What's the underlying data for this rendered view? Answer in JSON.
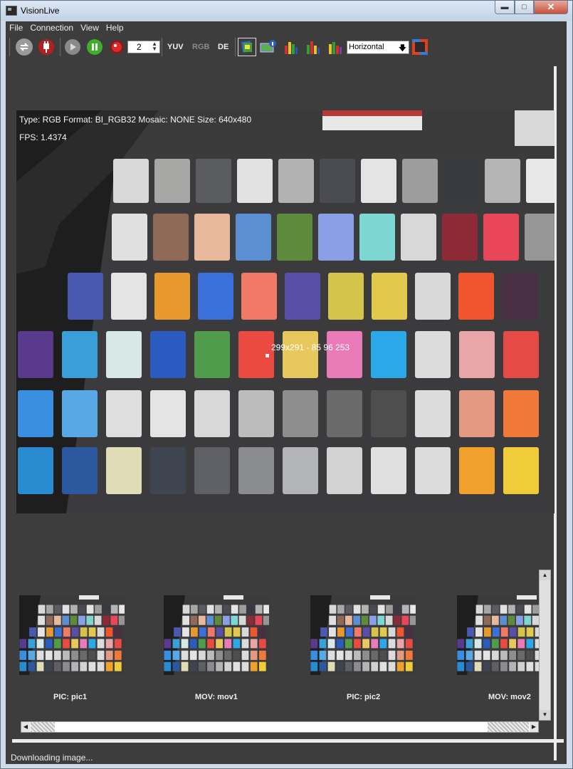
{
  "window": {
    "title": "VisionLive"
  },
  "menu": {
    "items": [
      "File",
      "Connection",
      "View",
      "Help"
    ]
  },
  "toolbar": {
    "icons": [
      "refresh-icon",
      "plug-icon",
      "play-icon",
      "pause-icon",
      "record-icon",
      "color-picture-icon",
      "monitor-info-icon",
      "histogram-icon",
      "histogram-icon",
      "histogram-icon",
      "layout-icon"
    ],
    "spin_value": "2",
    "yuv_label": "YUV",
    "rgb_label": "RGB",
    "de_label": "DE",
    "orientation": "Horizontal"
  },
  "viewer": {
    "info_line": "Type: RGB Format: BI_RGB32 Mosaic: NONE Size: 640x480",
    "fps_line": "FPS: 1.4374",
    "pixel_readout": "299x291 - 85 96 253"
  },
  "gallery": {
    "items": [
      {
        "label": "PIC: pic1"
      },
      {
        "label": "MOV: mov1"
      },
      {
        "label": "PIC: pic2"
      },
      {
        "label": "MOV: mov2"
      }
    ]
  },
  "status": {
    "text": "Downloading image..."
  },
  "chart_colors": {
    "row1": [
      "#d8d8d8",
      "#a7a7a5",
      "#5a5c60",
      "#e2e2e2",
      "#b2b2b2",
      "#4a4c52",
      "#e4e4e4",
      "#9d9d9d",
      "#383a40",
      "#b4b4b4",
      "#e8e8e8"
    ],
    "row2": [
      "#e0e0e0",
      "#8f6a57",
      "#e8b89c",
      "#5b8fd1",
      "#5e8a3c",
      "#8aa0e6",
      "#7ed6d2",
      "#d8d8d8",
      "#8c2a35",
      "#e8475a",
      "#969696"
    ],
    "row3": [
      "#4a58b0",
      "#e4e4e4",
      "#e8992e",
      "#3a70d8",
      "#f07a66",
      "#5a4ea6",
      "#d4c44a",
      "#e2c84c",
      "#d8d8d8",
      "#f0552e",
      "#4a2e44"
    ],
    "row4": [
      "#5a3a8c",
      "#3a9ed8",
      "#d8e8e6",
      "#2a5cc0",
      "#4f9c4a",
      "#ec4a40",
      "#e8c85c",
      "#ea7ab8",
      "#2aa8e8",
      "#dcdcdc",
      "#e9a6a8",
      "#e64a44"
    ],
    "row5": [
      "#3a8ee0",
      "#58a8e6",
      "#dedede",
      "#e4e4e4",
      "#d8d8d8",
      "#bcbcbc",
      "#8e8e8e",
      "#6a6a6a",
      "#4e4e4e",
      "#dcdcdc",
      "#e49a82",
      "#f07838"
    ],
    "row6": [
      "#2a8cd0",
      "#2c58a0",
      "#e0dcb8",
      "#3e4550",
      "#5e6066",
      "#8a8c90",
      "#b2b4b6",
      "#d2d2d2",
      "#e0e0e0",
      "#dcdcdc",
      "#f0a02c",
      "#f0cc3a"
    ]
  }
}
